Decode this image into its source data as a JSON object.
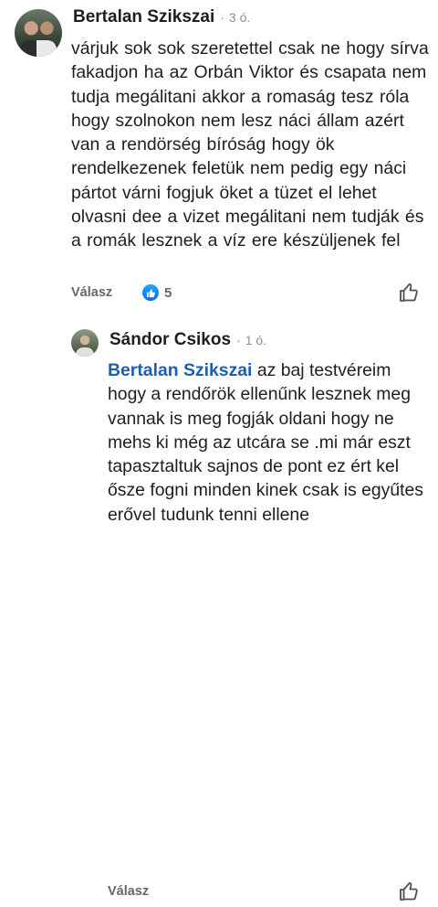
{
  "comment": {
    "author": "Bertalan Szikszai",
    "separator": "·",
    "time": "3 ó.",
    "text": "várjuk sok sok szeretettel csak  ne hogy sírva fakadjon ha  az  Orbán Viktor és csapata  nem  tudja  megálitani akkor a romaság tesz róla  hogy  szolnokon  nem lesz  náci  állam azért  van  a rendörség bíróság  hogy  ök rendelkezenek  feletük nem  pedig  egy  náci pártot  várni  fogjuk öket  a tüzet  el lehet  olvasni dee  a vizet megálitani nem tudják és  a romák lesznek a  víz  ere  készüljenek fel",
    "reply_label": "Válasz",
    "reaction_count": "5",
    "reaction_icon": "like-reaction-icon",
    "like_icon": "thumbs-up-outline-icon"
  },
  "reply": {
    "author": "Sándor Csikos",
    "separator": "·",
    "time": "1 ó.",
    "mention": "Bertalan Szikszai",
    "text": " az baj testvéreim hogy a rendőrök ellenűnk lesznek meg vannak is meg fogják oldani hogy ne mehs ki még az utcára se .mi már eszt tapasztaltuk sajnos de pont ez ért kel ősze fogni minden kinek csak is egyűtes erővel tudunk tenni ellene",
    "reply_label": "Válasz",
    "like_icon": "thumbs-up-outline-icon"
  },
  "colors": {
    "mention": "#1b5fb3",
    "meta": "#65676b",
    "reaction": "#0866ff"
  }
}
